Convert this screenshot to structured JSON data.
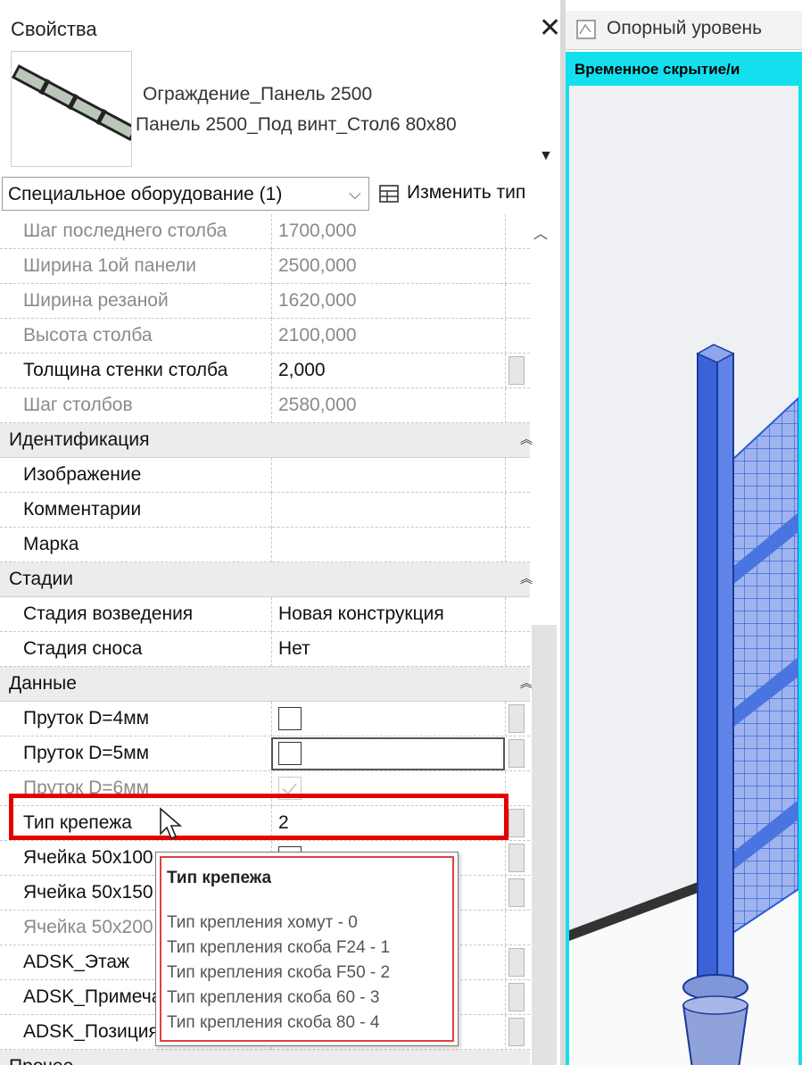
{
  "properties": {
    "title": "Свойства",
    "close_glyph": "✕",
    "type_name_line1": "Ограждение_Панель 2500",
    "type_name_line2": "Панель 2500_Под винт_Стол6 80x80",
    "category_selector": "Специальное оборудование (1)",
    "edit_type_label": "Изменить тип",
    "rows": [
      {
        "name": "Шаг последнего столба",
        "value": "1700,000",
        "dim": true
      },
      {
        "name": "Ширина 1ой панели",
        "value": "2500,000",
        "dim": true
      },
      {
        "name": "Ширина резаной",
        "value": "1620,000",
        "dim": true
      },
      {
        "name": "Высота столба",
        "value": "2100,000",
        "dim": true
      },
      {
        "name": "Толщина стенки столба",
        "value": "2,000",
        "dim": false
      },
      {
        "name": "Шаг столбов",
        "value": "2580,000",
        "dim": true
      },
      {
        "group": "Идентификация"
      },
      {
        "name": "Изображение",
        "value": ""
      },
      {
        "name": "Комментарии",
        "value": ""
      },
      {
        "name": "Марка",
        "value": ""
      },
      {
        "group": "Стадии"
      },
      {
        "name": "Стадия возведения",
        "value": "Новая конструкция"
      },
      {
        "name": "Стадия сноса",
        "value": "Нет"
      },
      {
        "group": "Данные"
      },
      {
        "name": "Пруток D=4мм",
        "checkbox": "unchecked"
      },
      {
        "name": "Пруток D=5мм",
        "checkbox": "unchecked"
      },
      {
        "name": "Пруток D=6мм",
        "checkbox": "checked-disabled"
      },
      {
        "name": "Тип крепежа",
        "value": "2"
      },
      {
        "name": "Ячейка 50x100",
        "value": ""
      },
      {
        "name": "Ячейка 50x150",
        "value": ""
      },
      {
        "name": "Ячейка 50x200",
        "value": ""
      },
      {
        "name": "ADSK_Этаж",
        "value": ""
      },
      {
        "name": "ADSK_Примечание",
        "value": ""
      },
      {
        "name": "ADSK_Позиция",
        "value": ""
      },
      {
        "group": "Прочее"
      }
    ],
    "tooltip": {
      "title": "Тип крепежа",
      "lines": [
        "Тип крепления хомут       - 0",
        "Тип крепления скоба F24 - 1",
        "Тип крепления скоба F50 - 2",
        "Тип крепления скоба   60 - 3",
        "Тип крепления скоба   80 - 4"
      ]
    }
  },
  "view": {
    "tab_label": "Опорный уровень",
    "banner": "Временное скрытие/и"
  },
  "colors": {
    "highlight": "#e60000",
    "view_border": "#13e0ee",
    "model_blue": "#2a5bd8"
  },
  "icons": [
    "close-icon",
    "type-dropdown-icon",
    "chevron-down-icon",
    "edit-type-icon",
    "collapse-icon",
    "scroll-up-icon",
    "view-tab-icon",
    "mouse-cursor-icon"
  ]
}
